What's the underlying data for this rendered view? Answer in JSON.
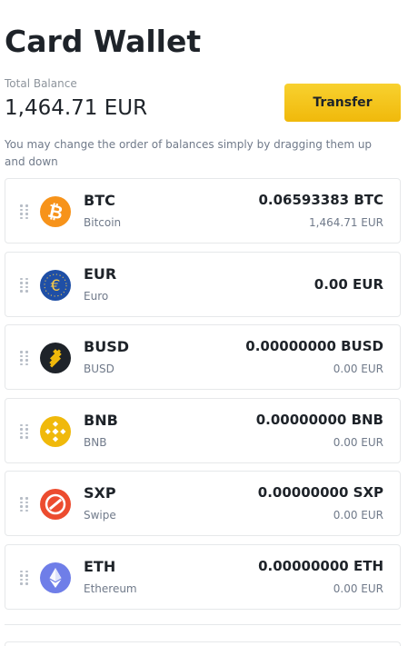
{
  "header": {
    "title": "Card Wallet"
  },
  "balance": {
    "label": "Total Balance",
    "value": "1,464.71 EUR"
  },
  "actions": {
    "transfer_label": "Transfer"
  },
  "hint": "You may change the order of balances simply by dragging them up and down",
  "cards": [
    {
      "symbol": "BTC",
      "name": "Bitcoin",
      "amount": "0.06593383 BTC",
      "fiat": "1,464.71 EUR",
      "icon": "bitcoin-icon",
      "color": "#f7931a"
    },
    {
      "symbol": "EUR",
      "name": "Euro",
      "amount": "0.00 EUR",
      "fiat": "",
      "icon": "euro-icon",
      "color": "#1f4fa6"
    },
    {
      "symbol": "BUSD",
      "name": "BUSD",
      "amount": "0.00000000 BUSD",
      "fiat": "0.00 EUR",
      "icon": "busd-icon",
      "color": "#1e2329"
    },
    {
      "symbol": "BNB",
      "name": "BNB",
      "amount": "0.00000000 BNB",
      "fiat": "0.00 EUR",
      "icon": "bnb-icon",
      "color": "#f0b90b"
    },
    {
      "symbol": "SXP",
      "name": "Swipe",
      "amount": "0.00000000 SXP",
      "fiat": "0.00 EUR",
      "icon": "swipe-icon",
      "color": "#ec4c2f"
    },
    {
      "symbol": "ETH",
      "name": "Ethereum",
      "amount": "0.00000000 ETH",
      "fiat": "0.00 EUR",
      "icon": "ethereum-icon",
      "color": "#6f7ee8"
    }
  ]
}
